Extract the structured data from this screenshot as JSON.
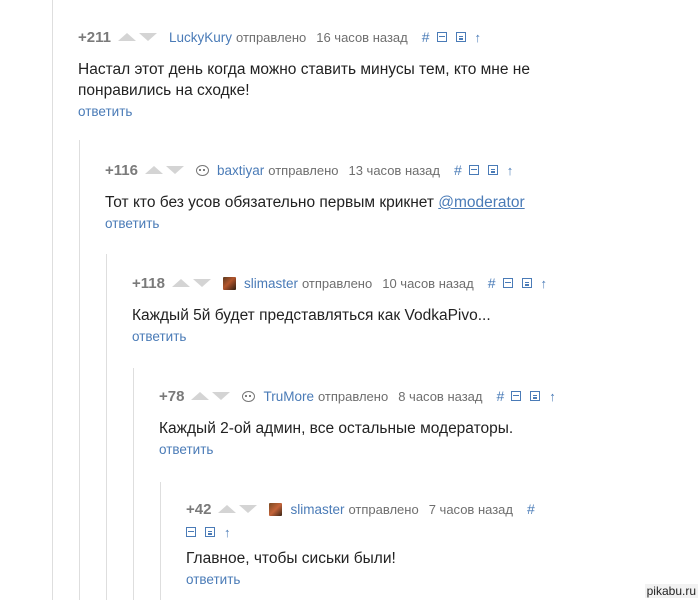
{
  "comments": [
    {
      "score": "+211",
      "user": "LuckyKury",
      "sent_label": "отправлено",
      "time": "16 часов назад",
      "text": "Настал этот день когда можно ставить минусы тем, кто мне не понравились на сходке!",
      "reply": "ответить",
      "avatar": "none"
    },
    {
      "score": "+116",
      "user": "baxtiyar",
      "sent_label": "отправлено",
      "time": "13 часов назад",
      "text": "Тот кто без усов обязательно первым крикнет ",
      "mention": "@moderator",
      "reply": "ответить",
      "avatar": "face-icon"
    },
    {
      "score": "+118",
      "user": "slimaster",
      "sent_label": "отправлено",
      "time": "10 часов назад",
      "text": "Каждый 5й будет представляться как VodkaPivo...",
      "reply": "ответить",
      "avatar": "user-picture"
    },
    {
      "score": "+78",
      "user": "TruMore",
      "sent_label": "отправлено",
      "time": "8 часов назад",
      "text": "Каждый 2-ой админ, все остальные модераторы.",
      "reply": "ответить",
      "avatar": "face-icon"
    },
    {
      "score": "+42",
      "user": "slimaster",
      "sent_label": "отправлено",
      "time": "7 часов назад",
      "text": "Главное, чтобы сиськи были!",
      "reply": "ответить",
      "avatar": "user-picture"
    }
  ],
  "controls": {
    "hash": "#",
    "up_arrow": "↑"
  },
  "watermark": "pikabu.ru"
}
